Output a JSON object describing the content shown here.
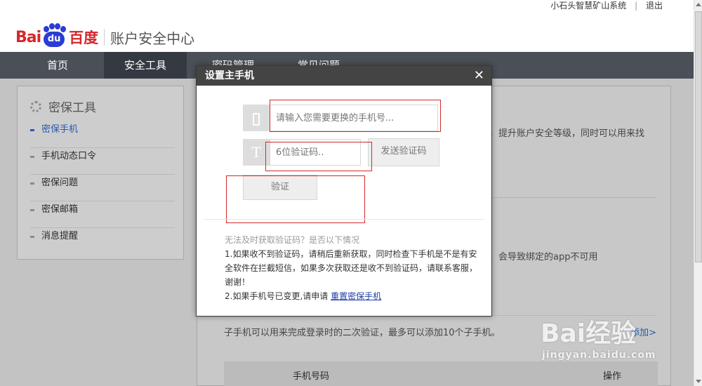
{
  "topbar": {
    "user": "小石头智慧矿山系统",
    "separator": "|",
    "logout": "退出"
  },
  "brand": {
    "logo_left": "Bai",
    "logo_du": "du",
    "logo_cn": "百度",
    "site_title": "账户安全中心"
  },
  "nav": {
    "tabs": [
      {
        "label": "首页"
      },
      {
        "label": "安全工具"
      },
      {
        "label": "密码管理"
      },
      {
        "label": "常见问题"
      }
    ]
  },
  "sidebar": {
    "title": "密保工具",
    "items": [
      {
        "label": "密保手机"
      },
      {
        "label": "手机动态口令"
      },
      {
        "label": "密保问题"
      },
      {
        "label": "密保邮箱"
      },
      {
        "label": "消息提醒"
      }
    ]
  },
  "content": {
    "line1": "，提升账户安全等级，同时可以用来找",
    "line2": "，会导致绑定的app不可用",
    "sub_info": "子手机可以用来完成登录时的二次验证，最多可以添加10个子手机。",
    "add_link": "添加>",
    "table_headers": [
      "手机号码",
      "操作"
    ]
  },
  "modal": {
    "title": "设置主手机",
    "close": "✕",
    "phone_placeholder": "请输入您需要更换的手机号...",
    "code_placeholder": "6位验证码..",
    "send_code": "发送验证码",
    "verify": "验证",
    "code_icon": "T",
    "help_question": "无法及时获取验证码？是否以下情况",
    "help_1": "1.如果收不到验证码，请稍后重新获取，同时检查下手机是不是有安全软件在拦截短信，如果多次获取还是收不到验证码，请联系客服，谢谢！",
    "help_2": "2.如果手机号已变更,请申请",
    "help_link": "重置密保手机"
  },
  "watermark": {
    "big": "Bai经验",
    "small": "jingyan.baidu.com"
  }
}
